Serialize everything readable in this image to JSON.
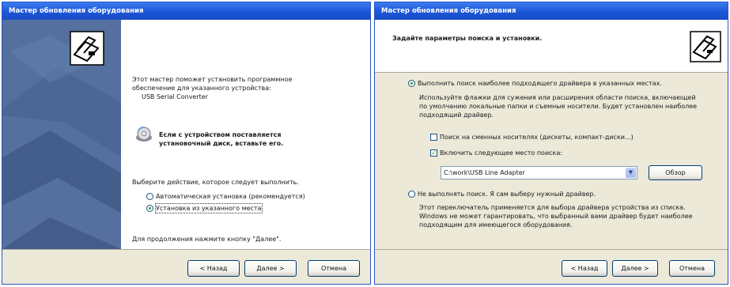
{
  "left_window": {
    "title": "Мастер обновления оборудования",
    "intro_line1": "Этот мастер поможет установить программное",
    "intro_line2": "обеспечение для указанного устройства:",
    "device_name": "USB Serial Converter",
    "cd_line1": "Если с устройством поставляется",
    "cd_line2": "установочный диск, вставьте его.",
    "choose_action": "Выберите действие, которое следует выполнить.",
    "option_auto": "Автоматическая установка (рекомендуется)",
    "option_manual": "Установка из указанного места",
    "continue_hint": "Для продолжения нажмите кнопку \"Далее\".",
    "buttons": {
      "back": "< Назад",
      "next": "Далее >",
      "cancel": "Отмена"
    }
  },
  "right_window": {
    "title": "Мастер обновления оборудования",
    "header_title": "Задайте параметры поиска и установки.",
    "option_search": "Выполнить поиск наиболее подходящего драйвера в указанных местах.",
    "search_desc_line1": "Используйте флажки для сужения или расширения области поиска, включающей",
    "search_desc_line2": "по умолчанию локальные папки и съемные носители. Будет установлен наиболее",
    "search_desc_line3": "подходящий драйвер.",
    "chk_removable": "Поиск на сменных носителях (дискеты, компакт-диски...)",
    "chk_include_path": "Включить следующее место поиска:",
    "path_value": "C:\\work\\USB Line Adapter",
    "browse_button": "Обзор",
    "option_no_search": "Не выполнять поиск. Я сам выберу нужный драйвер.",
    "nosearch_desc_line1": "Этот переключатель применяется для выбора драйвера устройства из списка.",
    "nosearch_desc_line2": "Windows не может гарантировать, что выбранный вами драйвер будет наиболее",
    "nosearch_desc_line3": "подходящим для имеющегося оборудования.",
    "buttons": {
      "back": "< Назад",
      "next": "Далее >",
      "cancel": "Отмена"
    }
  },
  "colors": {
    "titlebar": "#1b56d8",
    "sidebar": "#55709e",
    "dialog_bg": "#ece9d8",
    "radio_dot": "#21a121"
  }
}
